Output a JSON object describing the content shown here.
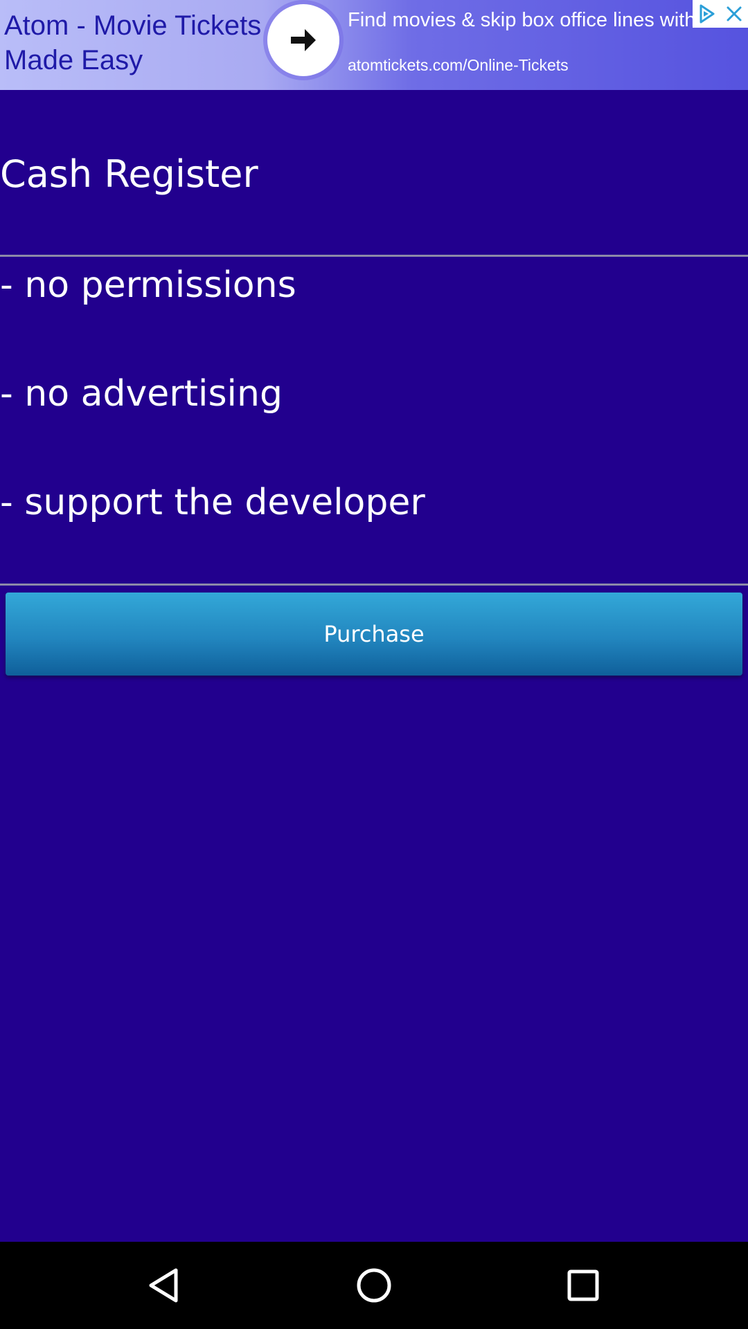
{
  "ad": {
    "headline": "Atom - Movie Tickets Made Easy",
    "description": "Find movies & skip box office lines with tickets sent straight to your phone!",
    "url": "atomtickets.com/Online-Tickets",
    "arrow_icon": "arrow-right-icon",
    "choices_icon": "ad-choices-icon",
    "close_icon": "close-icon"
  },
  "main": {
    "title": "Cash Register",
    "features": [
      "- no permissions",
      "- no advertising",
      "- support the developer"
    ],
    "purchase_label": "Purchase"
  },
  "navbar": {
    "back_icon": "back-triangle-icon",
    "home_icon": "home-circle-icon",
    "recents_icon": "recents-square-icon"
  },
  "colors": {
    "background": "#22008e",
    "button": "#2286bf",
    "divider": "#8c8aa8",
    "text": "#ffffff"
  }
}
